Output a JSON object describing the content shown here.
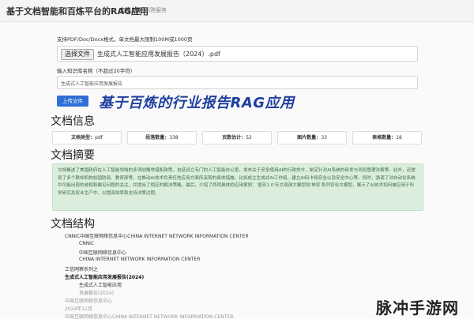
{
  "header": {
    "title": "基于文档智能和百炼平台的RAG应用",
    "nav": [
      "文档上传",
      "问答服务"
    ]
  },
  "upload": {
    "hint": "支持PDF/Doc/Docx格式，单文档最大限制100M或1000页",
    "choose_label": "选择文件",
    "file_name": "生成式人工智能应用发展报告（2024）.pdf",
    "kb_label": "输入知识库名称（不超过20字符）",
    "kb_value": "生成式人工智能应用发展报告",
    "upload_label": "上传文件"
  },
  "banner": "基于百炼的行业报告RAG应用",
  "info": {
    "heading": "文档信息",
    "stats": [
      {
        "key": "文档类型：",
        "value": "pdf"
      },
      {
        "key": "段落数量：",
        "value": "338"
      },
      {
        "key": "页数估计：",
        "value": "52"
      },
      {
        "key": "图片数量：",
        "value": "33"
      },
      {
        "key": "表格数量：",
        "value": "18"
      }
    ]
  },
  "summary": {
    "heading": "文档摘要",
    "text": "文档概述了美国政府在人工智能领域的多项战略举措和政策，包括设立专门的人工智能办公室、发布关于安全使用AI的行政命令、制定针对AI系统的研发与风险管理法案等。此外，还提到了多个联邦机构如国防部、教育部等，在推动AI技术负责任地应用方面所采取的具体措施，比如成立生成式AI工作组、建立AI码卡和安全以及安全中心等。同时，强调了对自动化系统中可能出现的歧视和偏见问题的关注，并提出了相应的解决策略。最后，介绍了两项具体的应用案例：'盖亚1.0'天文观测大模型和'神农'系列农业大模型，展示了AI技术如何被应用于科学研究及农业生产中，以提高效率和支持决策过程。"
  },
  "structure": {
    "heading": "文档结构",
    "items": [
      "CNNIC中国互联网络信息中心CHINA INTERNET NETWORK INFORMATION CENTER",
      "CNNIC",
      "中国互联网络信息中心",
      "CHINA INTERNET NETWORK INFORMATION CENTER",
      "工信网察系列之",
      "生成式人工智能应用发展报告(2024)",
      "生成式人工智能应用",
      "发展报告(2024)",
      "中国互联网络信息中心",
      "2024年11月",
      "中国互联网络信息中心CHINA INTERNET NETWORK INFORMATION CENTER"
    ]
  },
  "watermark": "脉冲手游网"
}
